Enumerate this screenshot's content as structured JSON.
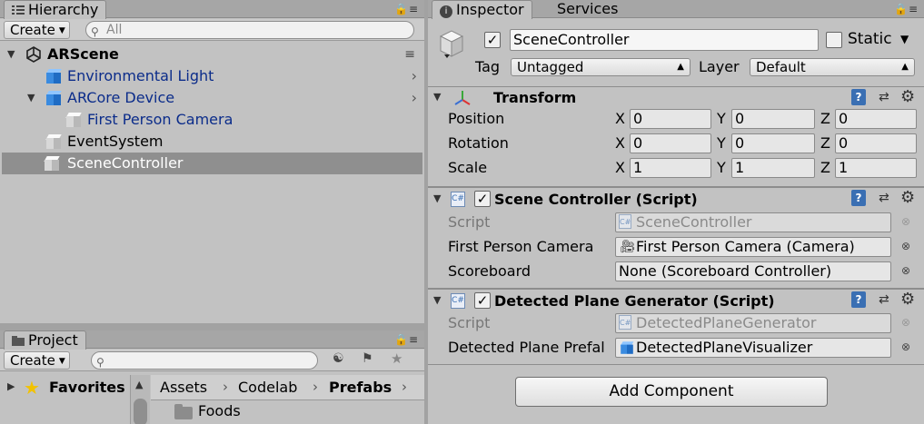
{
  "hierarchy": {
    "tab_label": "Hierarchy",
    "create_label": "Create",
    "search_placeholder": "All",
    "scene_name": "ARScene",
    "items": [
      {
        "label": "Environmental Light"
      },
      {
        "label": "ARCore Device"
      },
      {
        "label": "First Person Camera"
      },
      {
        "label": "EventSystem"
      },
      {
        "label": "SceneController"
      }
    ]
  },
  "project": {
    "tab_label": "Project",
    "create_label": "Create",
    "search_placeholder": "",
    "favorites_label": "Favorites",
    "breadcrumb": [
      "Assets",
      "Codelab",
      "Prefabs"
    ],
    "folder_label": "Foods"
  },
  "inspector": {
    "tabs": [
      "Inspector",
      "Services"
    ],
    "object_name": "SceneController",
    "active": true,
    "static_label": "Static",
    "static_checked": false,
    "tag_label": "Tag",
    "tag_value": "Untagged",
    "layer_label": "Layer",
    "layer_value": "Default",
    "transform": {
      "title": "Transform",
      "rows": [
        {
          "label": "Position",
          "x": "0",
          "y": "0",
          "z": "0"
        },
        {
          "label": "Rotation",
          "x": "0",
          "y": "0",
          "z": "0"
        },
        {
          "label": "Scale",
          "x": "1",
          "y": "1",
          "z": "1"
        }
      ],
      "axis_labels": [
        "X",
        "Y",
        "Z"
      ]
    },
    "scene_controller": {
      "title": "Scene Controller (Script)",
      "script_label": "Script",
      "script_value": "SceneController",
      "fpc_label": "First Person Camera",
      "fpc_value": "First Person Camera (Camera)",
      "scoreboard_label": "Scoreboard",
      "scoreboard_value": "None (Scoreboard Controller)"
    },
    "plane_generator": {
      "title": "Detected Plane Generator (Script)",
      "script_label": "Script",
      "script_value": "DetectedPlaneGenerator",
      "prefab_label": "Detected Plane Prefal",
      "prefab_value": "DetectedPlaneVisualizer"
    },
    "add_component_label": "Add Component",
    "cs_icon_text": "C#"
  }
}
